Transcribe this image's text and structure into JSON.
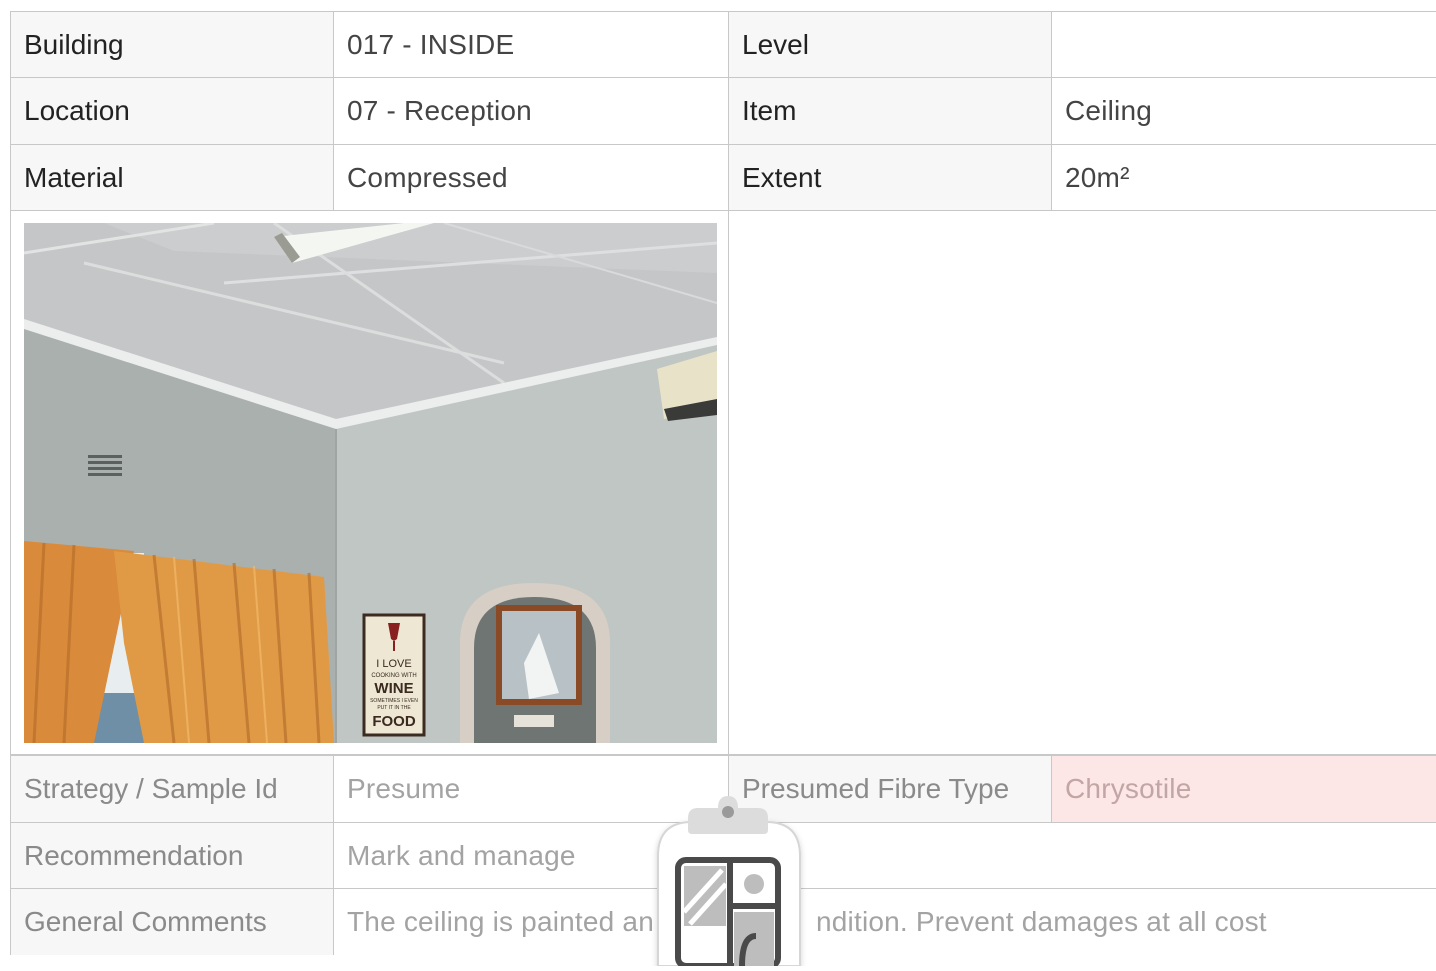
{
  "details": {
    "building_label": "Building",
    "building_value": "017 - INSIDE",
    "level_label": "Level",
    "level_value": "",
    "location_label": "Location",
    "location_value": "07 - Reception",
    "item_label": "Item",
    "item_value": "Ceiling",
    "material_label": "Material",
    "material_value": "Compressed",
    "extent_label": "Extent",
    "extent_value": "20m²"
  },
  "photo": {
    "sign_lines": [
      "I LOVE",
      "COOKING WITH",
      "WINE",
      "SOMETIMES I EVEN",
      "PUT IT IN THE",
      "FOOD"
    ]
  },
  "assessment": {
    "strategy_label": "Strategy / Sample Id",
    "strategy_value": "Presume",
    "fibre_label": "Presumed Fibre Type",
    "fibre_value": "Chrysotile",
    "recommendation_label": "Recommendation",
    "recommendation_value": "Mark and manage",
    "comments_label": "General Comments",
    "comments_value": "The ceiling is painted an",
    "comments_value_tail": "ndition. Prevent damages at all cost"
  },
  "overlay": {
    "icon": "clipboard-gallery-icon"
  },
  "colors": {
    "label_bg": "#f7f7f7",
    "border": "#c8c8c8",
    "alert_bg": "#fde6e6"
  }
}
